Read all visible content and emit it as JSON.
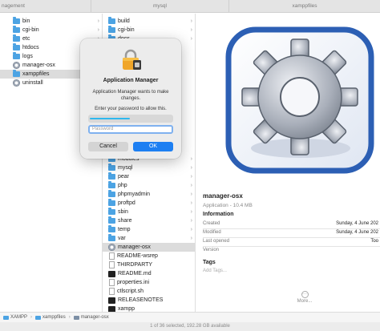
{
  "tabs": [
    "nagement",
    "mysql",
    "xamppfiles"
  ],
  "column1": {
    "items": [
      {
        "label": "bin",
        "icon": "folder-icon",
        "selected": false
      },
      {
        "label": "cgi-bin",
        "icon": "folder-icon",
        "selected": false
      },
      {
        "label": "etc",
        "icon": "folder-icon",
        "selected": false
      },
      {
        "label": "htdocs",
        "icon": "folder-icon",
        "selected": false
      },
      {
        "label": "logs",
        "icon": "folder-icon",
        "selected": false
      },
      {
        "label": "manager-osx",
        "icon": "app-icon",
        "selected": false
      },
      {
        "label": "xamppfiles",
        "icon": "folder-icon",
        "selected": true
      },
      {
        "label": "uninstall",
        "icon": "app-icon",
        "selected": false
      }
    ]
  },
  "column2": {
    "items": [
      {
        "label": "build",
        "icon": "folder-icon",
        "selected": false
      },
      {
        "label": "cgi-bin",
        "icon": "folder-icon",
        "selected": false
      },
      {
        "label": "docs",
        "icon": "folder-icon",
        "selected": false
      },
      {
        "label": "modules",
        "icon": "folder-icon",
        "selected": false
      },
      {
        "label": "mysql",
        "icon": "folder-icon",
        "selected": false
      },
      {
        "label": "pear",
        "icon": "folder-icon",
        "selected": false
      },
      {
        "label": "php",
        "icon": "folder-icon",
        "selected": false
      },
      {
        "label": "phpmyadmin",
        "icon": "folder-icon",
        "selected": false
      },
      {
        "label": "proftpd",
        "icon": "folder-icon",
        "selected": false
      },
      {
        "label": "sbin",
        "icon": "folder-icon",
        "selected": false
      },
      {
        "label": "share",
        "icon": "folder-icon",
        "selected": false
      },
      {
        "label": "temp",
        "icon": "folder-icon",
        "selected": false
      },
      {
        "label": "var",
        "icon": "folder-icon",
        "selected": false
      },
      {
        "label": "manager-osx",
        "icon": "app-icon",
        "selected": true
      },
      {
        "label": "README-wsrep",
        "icon": "document-icon",
        "selected": false
      },
      {
        "label": "THIRDPARTY",
        "icon": "document-icon",
        "selected": false
      },
      {
        "label": "README.md",
        "icon": "executable-icon",
        "selected": false
      },
      {
        "label": "properties.ini",
        "icon": "document-icon",
        "selected": false
      },
      {
        "label": "ctlscript.sh",
        "icon": "document-icon",
        "selected": false
      },
      {
        "label": "RELEASENOTES",
        "icon": "executable-icon",
        "selected": false
      },
      {
        "label": "xampp",
        "icon": "executable-icon",
        "selected": false
      }
    ]
  },
  "preview": {
    "name": "manager-osx",
    "subtitle": "Application - 10.4 MB",
    "info_heading": "Information",
    "rows": [
      {
        "key": "Created",
        "value": "Sunday, 4 June 202"
      },
      {
        "key": "Modified",
        "value": "Sunday, 4 June 202"
      },
      {
        "key": "Last opened",
        "value": "Too"
      },
      {
        "key": "Version",
        "value": ""
      }
    ],
    "tags_heading": "Tags",
    "tags_placeholder": "Add Tags...",
    "more_label": "More..."
  },
  "pathbar": [
    "XAMPP",
    "xamppfiles",
    "manager-osx"
  ],
  "statusbar": "1 of 36 selected, 192.28 GB available",
  "dialog": {
    "title": "Application Manager",
    "message": "Application Manager wants to make changes.",
    "prompt": "Enter your password to allow this.",
    "password_placeholder": "Password",
    "cancel_label": "Cancel",
    "ok_label": "OK"
  },
  "colors": {
    "accent": "#1d7ff2",
    "folder": "#4ca3e3",
    "selection": "#dcdcdc"
  }
}
